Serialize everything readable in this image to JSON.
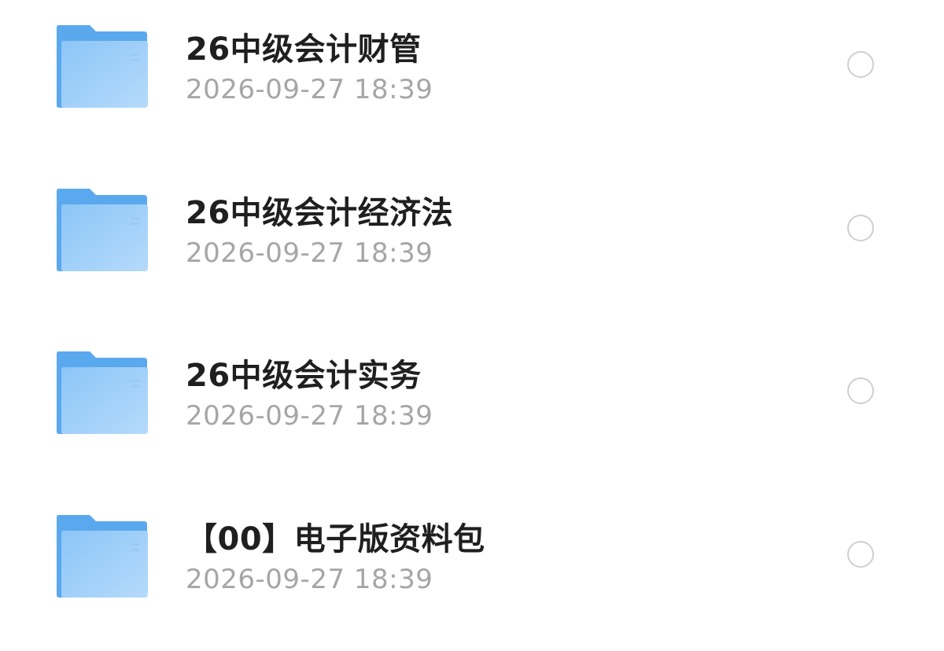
{
  "files": [
    {
      "name": "26中级会计财管",
      "time": "2026-09-27 18:39",
      "selected": false,
      "icon": "folder-icon"
    },
    {
      "name": "26中级会计经济法",
      "time": "2026-09-27 18:39",
      "selected": false,
      "icon": "folder-icon"
    },
    {
      "name": "26中级会计实务",
      "time": "2026-09-27 18:39",
      "selected": false,
      "icon": "folder-icon"
    },
    {
      "name": "【00】电子版资料包",
      "time": "2026-09-27 18:39",
      "selected": false,
      "icon": "folder-icon"
    }
  ],
  "colors": {
    "folder_back": "#5aa8ee",
    "folder_front_top": "#8cc6f7",
    "folder_front_bottom": "#b5dafb",
    "title_text": "#1f1f1f",
    "time_text": "#a6a6a6",
    "circle_border": "#cfcfd3"
  }
}
